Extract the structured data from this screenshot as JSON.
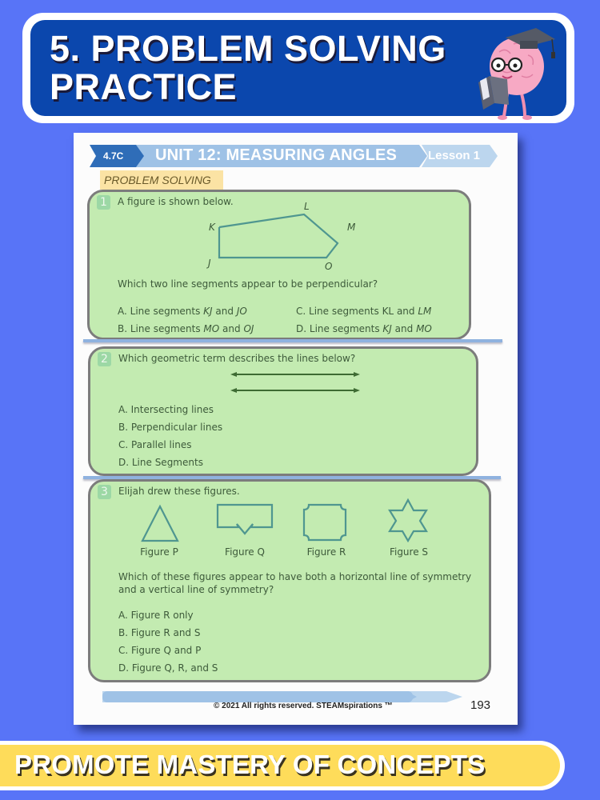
{
  "header": {
    "title_line1": "5. PROBLEM SOLVING",
    "title_line2": "PRACTICE",
    "mascot_icon": "brain-graduate-reading-icon"
  },
  "worksheet": {
    "unit_code": "4.7C",
    "unit_title": "UNIT 12: MEASURING ANGLES",
    "lesson": "Lesson 1",
    "section": "PROBLEM SOLVING",
    "questions": [
      {
        "number": "1",
        "prompt": "A figure is shown below.",
        "figure_vertices": [
          "K",
          "L",
          "M",
          "O",
          "J"
        ],
        "question": "Which two line segments appear to be perpendicular?",
        "options": [
          {
            "letter": "A.",
            "pre": "Line segments ",
            "s1": "KJ",
            "mid": " and ",
            "s2": "JO"
          },
          {
            "letter": "B.",
            "pre": "Line segments ",
            "s1": "MO",
            "mid": " and ",
            "s2": "OJ"
          },
          {
            "letter": "C.",
            "pre": "Line segments ",
            "s1": "KL",
            "mid": " and ",
            "s2": "LM"
          },
          {
            "letter": "D.",
            "pre": "Line segments ",
            "s1": "KJ",
            "mid": " and ",
            "s2": "MO"
          }
        ]
      },
      {
        "number": "2",
        "prompt": "Which geometric term describes the lines below?",
        "options": [
          "A. Intersecting lines",
          "B. Perpendicular lines",
          "C. Parallel lines",
          "D. Line Segments"
        ]
      },
      {
        "number": "3",
        "prompt": "Elijah drew these figures.",
        "figures": [
          "Figure P",
          "Figure Q",
          "Figure R",
          "Figure S"
        ],
        "question_line1": "Which of these figures appear to have both a horizontal line of symmetry",
        "question_line2": "and a vertical line of symmetry?",
        "options": [
          "A. Figure R only",
          "B. Figure R and S",
          "C. Figure Q and P",
          "D. Figure Q, R, and S"
        ]
      }
    ],
    "copyright": "© 2021 All rights reserved. STEAMspirations ™",
    "page_number": "193"
  },
  "footer": {
    "tagline": "PROMOTE MASTERY OF CONCEPTS"
  },
  "colors": {
    "background": "#5874f7",
    "banner_blue": "#0b47ad",
    "question_green": "#c3ebb1",
    "tagline_yellow": "#fedc5a",
    "shape_teal": "#4f9690"
  }
}
